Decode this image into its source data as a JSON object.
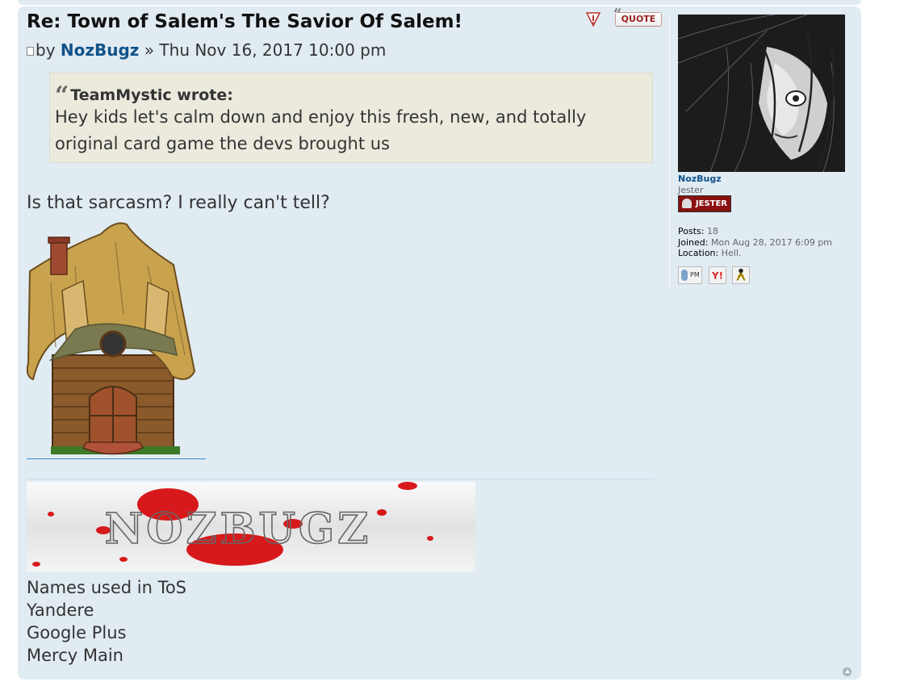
{
  "post": {
    "title": "Re: Town of Salem's The Savior Of Salem!",
    "quote_label": "QUOTE",
    "by_prefix": "by",
    "author": "NozBugz",
    "date_sep": "»",
    "date": "Thu Nov 16, 2017 10:00 pm",
    "quote": {
      "cite": "TeamMystic wrote:",
      "text": "Hey kids let's calm down and enjoy this fresh, new, and totally original card game the devs brought us"
    },
    "body_text": "Is that sarcasm? I really can't tell?",
    "signature": {
      "banner_text": "NOZBUGZ",
      "lines": [
        "Names used in ToS",
        "Yandere",
        "Google Plus",
        "Mercy Main"
      ]
    }
  },
  "profile": {
    "username": "NozBugz",
    "rank": "Jester",
    "rank_badge": "JESTER",
    "stats": [
      {
        "key": "Posts:",
        "value": "18"
      },
      {
        "key": "Joined:",
        "value": "Mon Aug 28, 2017 6:09 pm"
      },
      {
        "key": "Location:",
        "value": "Hell."
      }
    ],
    "contact_pm_label": "PM",
    "icons": [
      "report-icon",
      "quote-icon",
      "pm-icon",
      "yahoo-icon",
      "aim-icon",
      "back-to-top-icon"
    ]
  }
}
